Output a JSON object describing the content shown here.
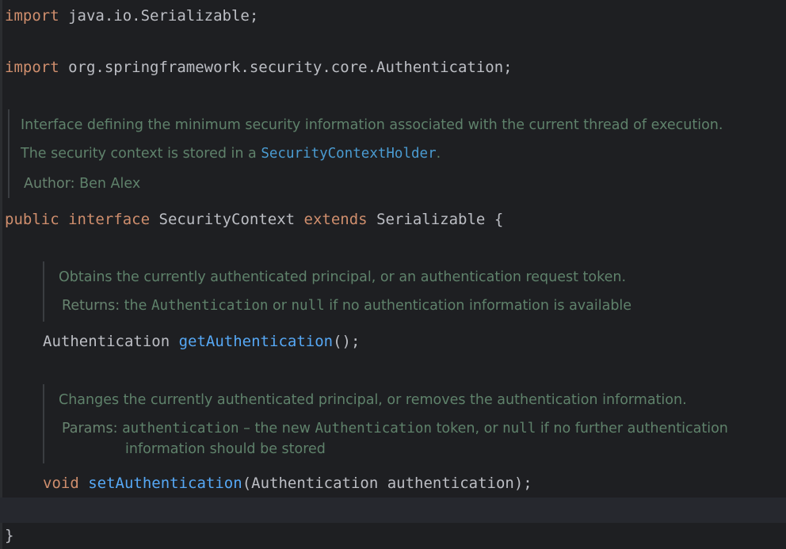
{
  "code": {
    "import1": {
      "kw": "import",
      "rest": " java.io.Serializable;"
    },
    "import2": {
      "kw": "import",
      "rest": " org.springframework.security.core.Authentication;"
    },
    "class_decl": {
      "kw1": "public",
      "kw2": "interface",
      "name": "SecurityContext",
      "kw3": "extends",
      "parent": "Serializable",
      "brace": "{"
    },
    "get_method": {
      "type": "Authentication",
      "name": "getAuthentication",
      "params": "();"
    },
    "set_method": {
      "type": "void",
      "name": "setAuthentication",
      "params": "(Authentication authentication);"
    },
    "close_brace": "}"
  },
  "docs": {
    "class_doc": {
      "line1": "Interface defining the minimum security information associated with the current thread of execution.",
      "line2_prefix": "The security context is stored in a ",
      "line2_link": "SecurityContextHolder",
      "line2_suffix": ".",
      "author_label": "Author:",
      "author_value": "Ben Alex"
    },
    "get_doc": {
      "line1": "Obtains the currently authenticated principal, or an authentication request token.",
      "returns_label": "Returns:",
      "returns_pre": "the ",
      "returns_code1": "Authentication",
      "returns_mid": " or ",
      "returns_code2": "null",
      "returns_post": " if no authentication information is available"
    },
    "set_doc": {
      "line1": "Changes the currently authenticated principal, or removes the authentication information.",
      "params_label": "Params:",
      "param_name": "authentication",
      "param_pre": " – the new ",
      "param_code1": "Authentication",
      "param_mid": " token, or ",
      "param_code2": "null",
      "param_post": " if no further authentication",
      "param_line2": "information should be stored"
    }
  }
}
